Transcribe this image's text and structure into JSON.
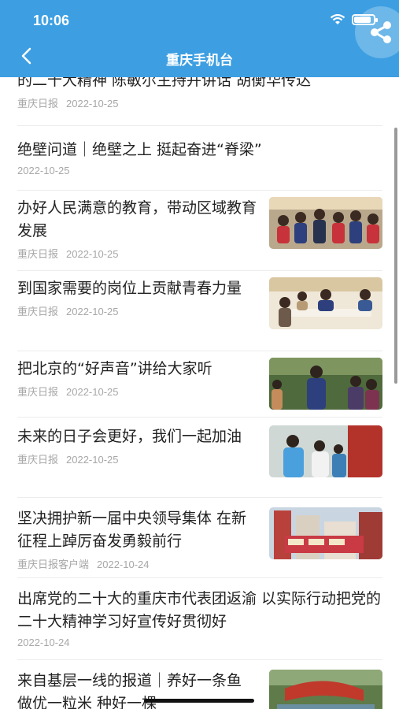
{
  "status": {
    "time": "10:06"
  },
  "header": {
    "title": "重庆手机台"
  },
  "articles": [
    {
      "title": "的二十大精神 陈敏尔主持并讲话 胡衡华传达",
      "source": "重庆日报",
      "date": "2022-10-25",
      "thumb": "none"
    },
    {
      "title": "绝壁问道｜绝壁之上 挺起奋进“脊梁”",
      "source": "",
      "date": "2022-10-25",
      "thumb": "none"
    },
    {
      "title": "办好人民满意的教育，带动区域教育发展",
      "source": "重庆日报",
      "date": "2022-10-25",
      "thumb": "students-classroom-photo"
    },
    {
      "title": "到国家需要的岗位上贡献青春力量",
      "source": "重庆日报",
      "date": "2022-10-25",
      "thumb": "meeting-table-photo"
    },
    {
      "title": "把北京的“好声音”讲给大家听",
      "source": "重庆日报",
      "date": "2022-10-25",
      "thumb": "speaker-crowd-photo"
    },
    {
      "title": "未来的日子会更好，我们一起加油",
      "source": "重庆日报",
      "date": "2022-10-25",
      "thumb": "medical-workers-photo"
    },
    {
      "title": "坚决拥护新一届中央领导集体 在新征程上踔厉奋发勇毅前行",
      "source": "重庆日报客户端",
      "date": "2022-10-24",
      "thumb": "city-street-photo"
    },
    {
      "title": "出席党的二十大的重庆市代表团返渝 以实际行动把党的二十大精神学习好宣传好贯彻好",
      "source": "",
      "date": "2022-10-24",
      "thumb": "none"
    },
    {
      "title": "来自基层一线的报道｜养好一条鱼 做优一粒米 种好一棵",
      "source": "",
      "date": "",
      "thumb": "river-village-photo"
    }
  ]
}
